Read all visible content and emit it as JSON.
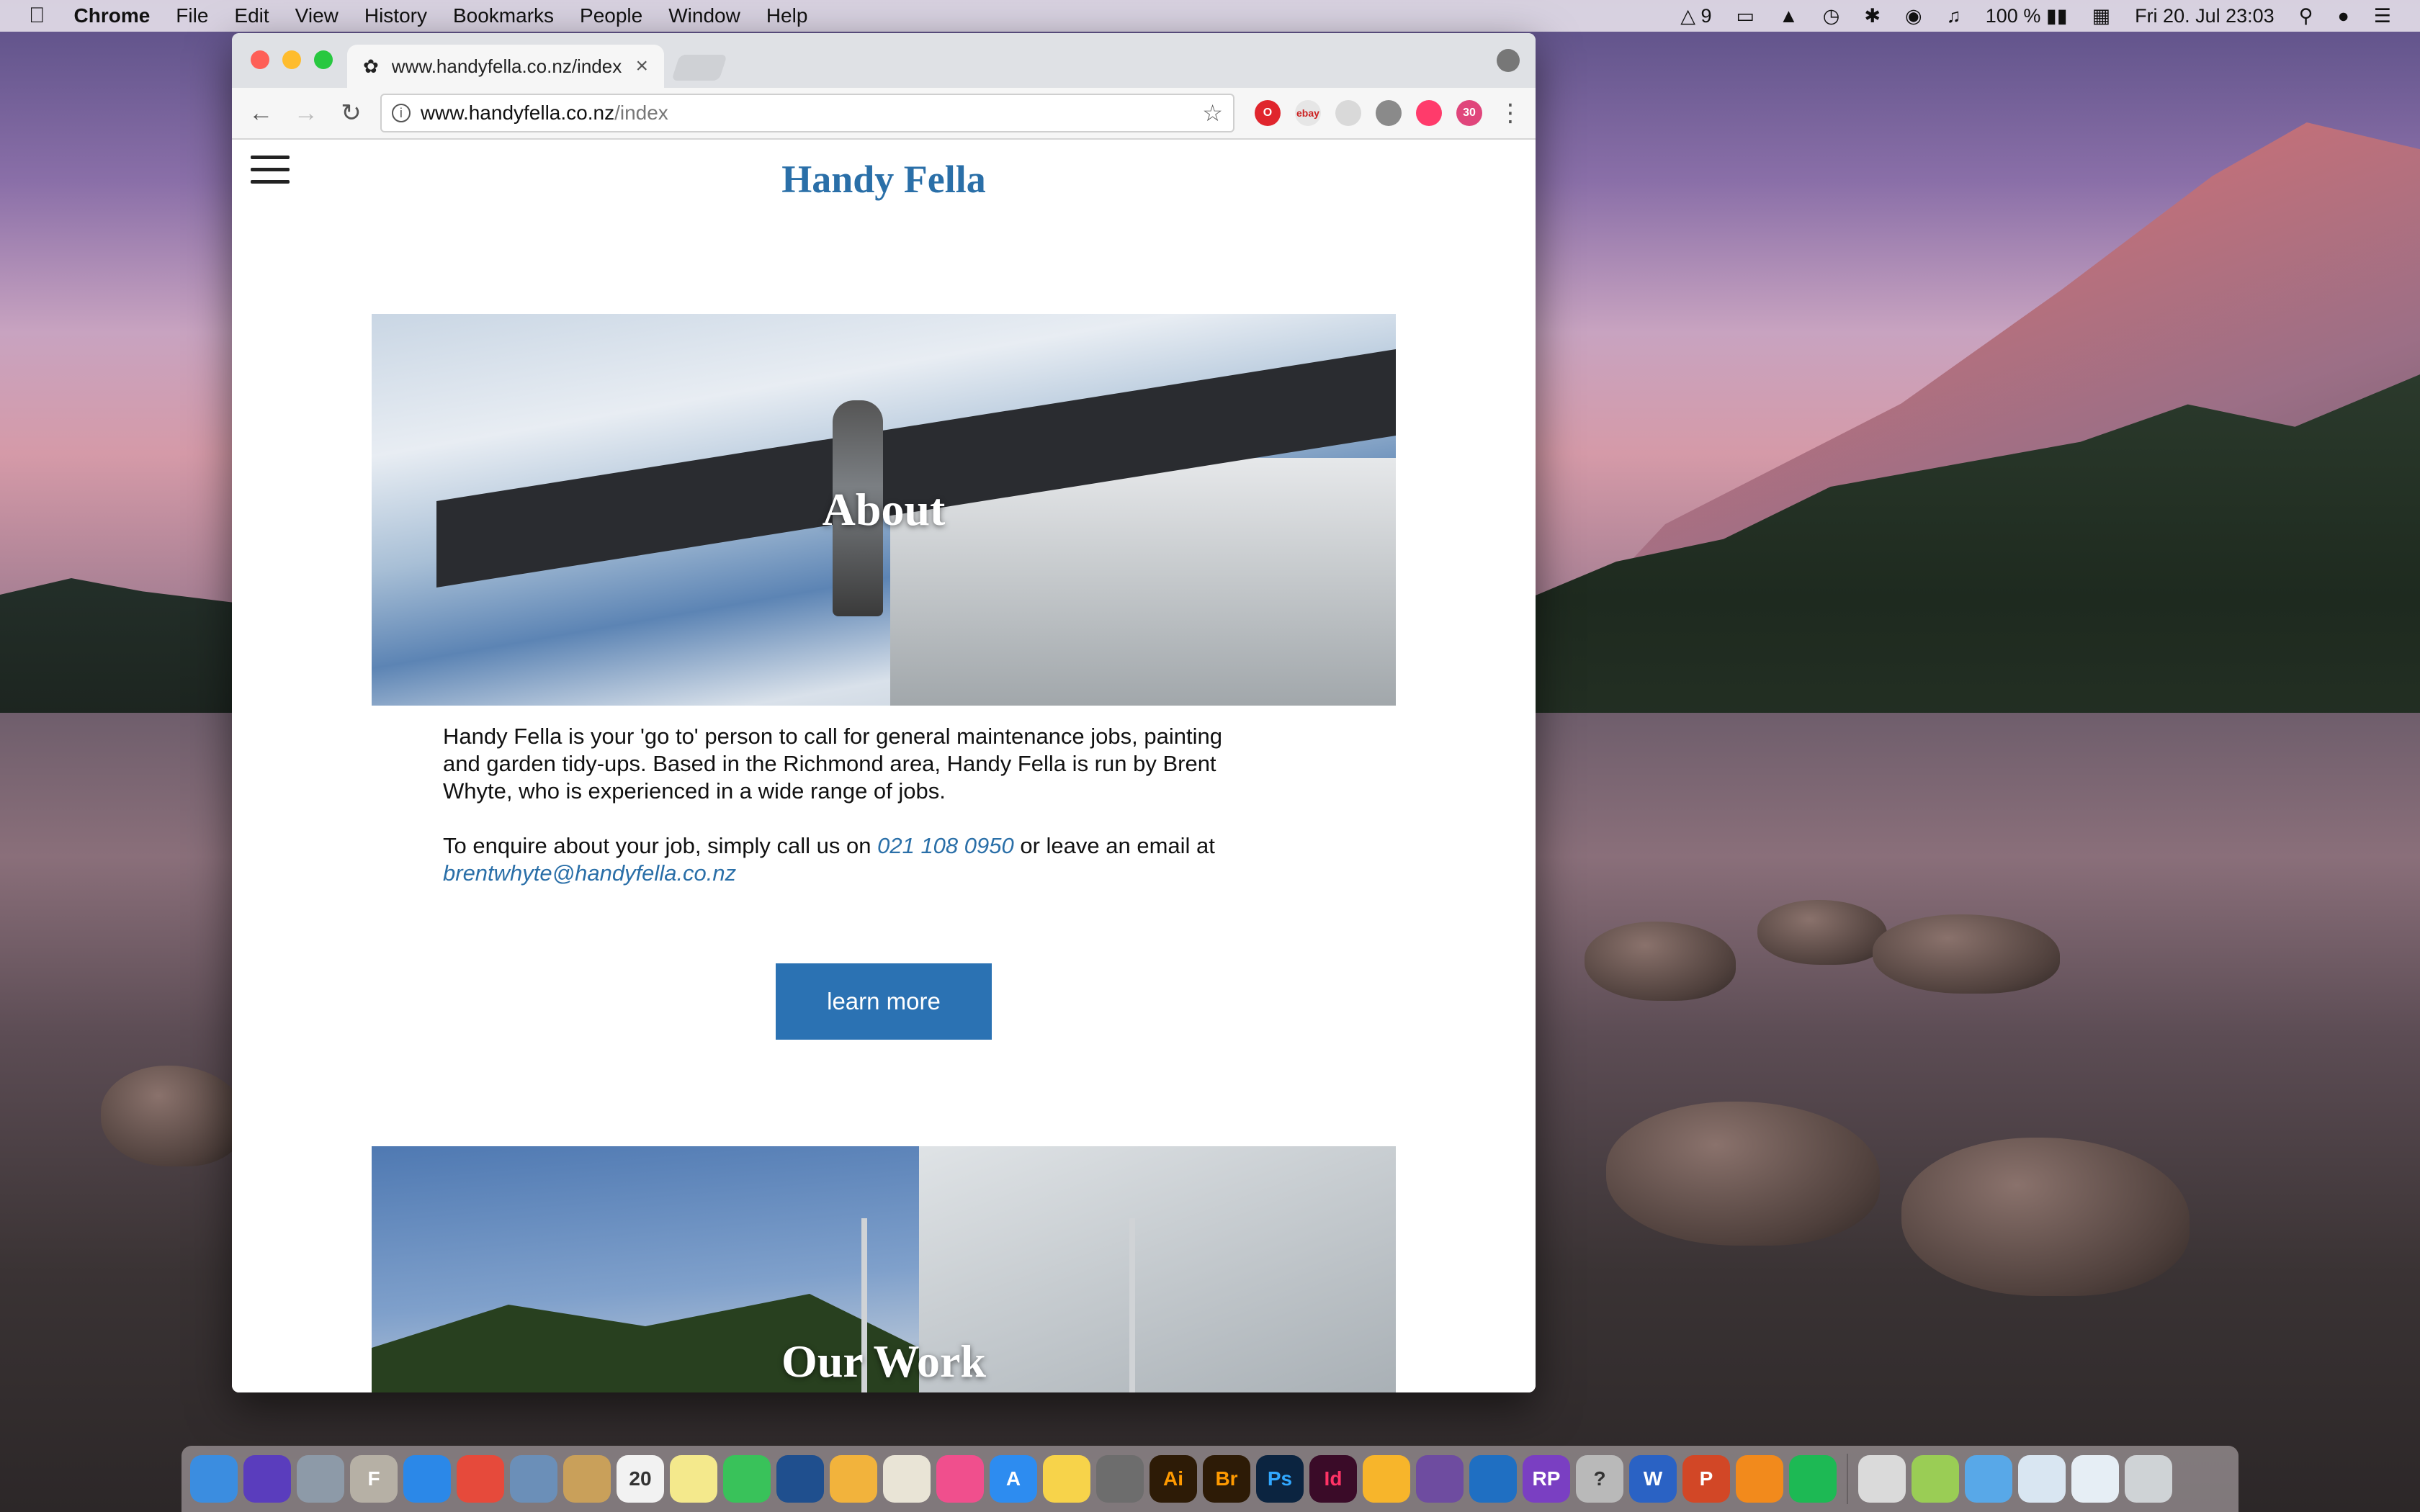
{
  "menubar": {
    "app_name": "Chrome",
    "menus": [
      "File",
      "Edit",
      "View",
      "History",
      "Bookmarks",
      "People",
      "Window",
      "Help"
    ],
    "status": {
      "adobe_count": "9",
      "battery": "100 %",
      "datetime": "Fri 20. Jul  23:03",
      "calendar_badge": "30"
    }
  },
  "browser": {
    "tab_title": "www.handyfella.co.nz/index",
    "url_host": "www.handyfella.co.nz",
    "url_path": "/index",
    "extensions": [
      {
        "icon": "opera-icon",
        "color": "#e0252d",
        "label": "O"
      },
      {
        "icon": "ebay-icon",
        "color": "#e6e6e6",
        "label": "ebay"
      },
      {
        "icon": "shortcut-icon",
        "color": "#d9d9d9",
        "label": ""
      },
      {
        "icon": "settings-gear-icon",
        "color": "#8a8a8a",
        "label": ""
      },
      {
        "icon": "color-wheel-icon",
        "color": "#ff3b6b",
        "label": ""
      },
      {
        "icon": "calendar-badge-icon",
        "color": "#e0457b",
        "label": "30"
      }
    ]
  },
  "site": {
    "title": "Handy Fella",
    "sections": [
      {
        "label": "About"
      },
      {
        "label": "Our Work"
      }
    ],
    "intro_p1": "Handy Fella is your 'go to' person to call for general maintenance jobs, painting and garden tidy-ups. Based in the Richmond area, Handy Fella is run by Brent Whyte, who is experienced in a wide range of jobs.",
    "intro_p2_prefix": "To enquire about your job, simply call us on ",
    "phone": "021 108 0950",
    "intro_p2_mid": " or leave an email at",
    "email": "brentwhyte@handyfella.co.nz",
    "button_label": "learn more"
  },
  "dock": {
    "apps": [
      {
        "name": "finder-icon",
        "color": "#3b8de0",
        "label": ""
      },
      {
        "name": "siri-icon",
        "color": "#5a3dbd",
        "label": ""
      },
      {
        "name": "launchpad-icon",
        "color": "#8d9aa8",
        "label": ""
      },
      {
        "name": "font-book-icon",
        "color": "#b6b0a5",
        "label": "F"
      },
      {
        "name": "safari-icon",
        "color": "#2b88e8",
        "label": ""
      },
      {
        "name": "chrome-icon",
        "color": "#e64a3b",
        "label": ""
      },
      {
        "name": "preview-icon",
        "color": "#6b8fb8",
        "label": ""
      },
      {
        "name": "notes-icon",
        "color": "#c9a05a",
        "label": ""
      },
      {
        "name": "calendar-icon",
        "color": "#f2f2f2",
        "label": "20"
      },
      {
        "name": "stickies-icon",
        "color": "#f4e98c",
        "label": ""
      },
      {
        "name": "messages-icon",
        "color": "#39c25a",
        "label": ""
      },
      {
        "name": "quicktime-icon",
        "color": "#1f4f8e",
        "label": ""
      },
      {
        "name": "photos-icon",
        "color": "#f2b33c",
        "label": ""
      },
      {
        "name": "textedit-icon",
        "color": "#e9e4d6",
        "label": ""
      },
      {
        "name": "itunes-icon",
        "color": "#f04f8d",
        "label": ""
      },
      {
        "name": "app-store-icon",
        "color": "#2d8cf0",
        "label": "A"
      },
      {
        "name": "cyberduck-icon",
        "color": "#f7d34a",
        "label": ""
      },
      {
        "name": "system-preferences-icon",
        "color": "#6d6d6d",
        "label": ""
      },
      {
        "name": "illustrator-icon",
        "color": "#2d1b06",
        "label": "Ai"
      },
      {
        "name": "bridge-icon",
        "color": "#2d1b06",
        "label": "Br"
      },
      {
        "name": "photoshop-icon",
        "color": "#0b2440",
        "label": "Ps"
      },
      {
        "name": "indesign-icon",
        "color": "#3a0b28",
        "label": "Id"
      },
      {
        "name": "sketch-icon",
        "color": "#f7b52b",
        "label": ""
      },
      {
        "name": "github-icon",
        "color": "#6e4ca0",
        "label": ""
      },
      {
        "name": "xcode-icon",
        "color": "#1f6fc2",
        "label": ""
      },
      {
        "name": "axure-icon",
        "color": "#7a3fc2",
        "label": "RP"
      },
      {
        "name": "help-icon",
        "color": "#b9b9b9",
        "label": "?"
      },
      {
        "name": "word-icon",
        "color": "#2a62c4",
        "label": "W"
      },
      {
        "name": "powerpoint-icon",
        "color": "#d24726",
        "label": "P"
      },
      {
        "name": "vlc-icon",
        "color": "#f28a1c",
        "label": ""
      },
      {
        "name": "spotify-icon",
        "color": "#1db954",
        "label": ""
      },
      {
        "name": "activity-monitor-icon",
        "color": "#dadada",
        "label": ""
      },
      {
        "name": "calculator-icon",
        "color": "#9acd55",
        "label": ""
      },
      {
        "name": "folder-icon",
        "color": "#58a8e8",
        "label": ""
      },
      {
        "name": "downloads-icon",
        "color": "#d9e6f2",
        "label": ""
      },
      {
        "name": "documents-icon",
        "color": "#e6eef5",
        "label": ""
      },
      {
        "name": "trash-icon",
        "color": "#cfd3d6",
        "label": ""
      }
    ]
  }
}
